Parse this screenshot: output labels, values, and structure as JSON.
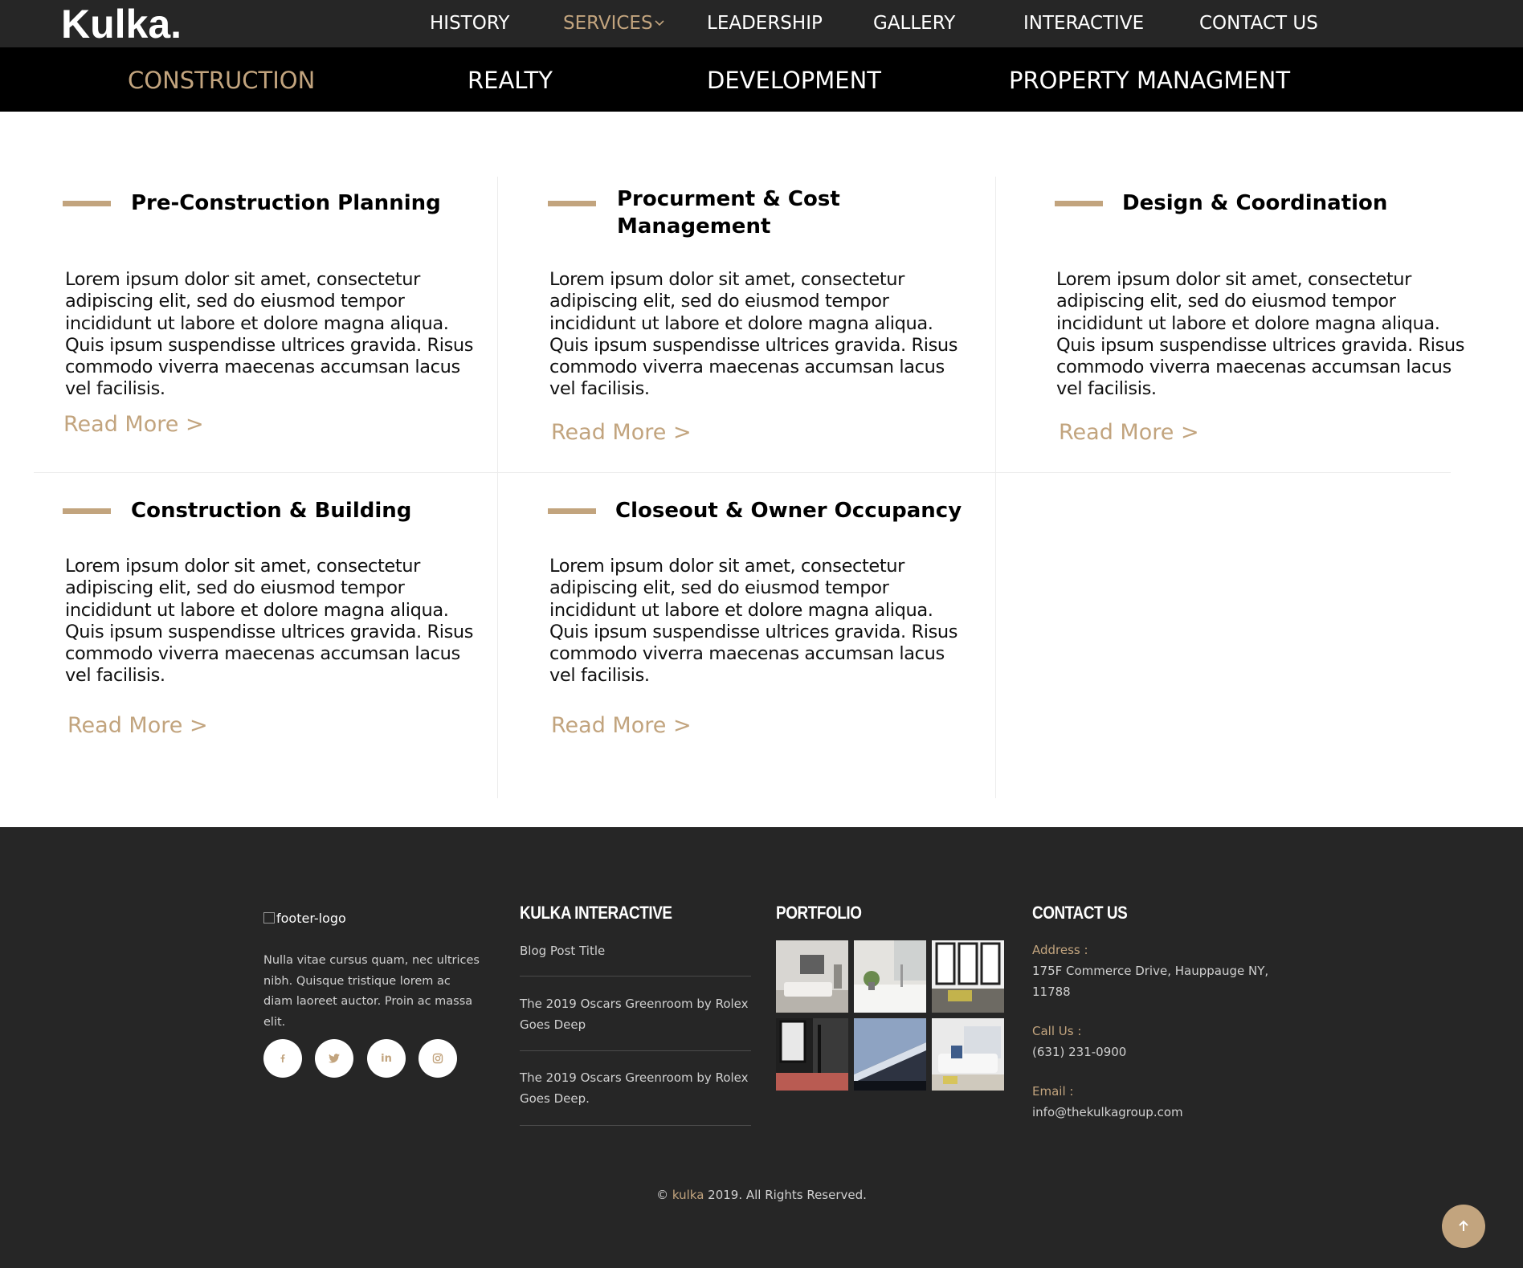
{
  "header": {
    "logo": "Kulka.",
    "nav": [
      {
        "label": "HISTORY"
      },
      {
        "label": "SERVICES"
      },
      {
        "label": "LEADERSHIP"
      },
      {
        "label": "GALLERY"
      },
      {
        "label": "INTERACTIVE"
      },
      {
        "label": "CONTACT US"
      }
    ],
    "active_nav": "SERVICES"
  },
  "subnav": {
    "items": [
      {
        "label": "CONSTRUCTION"
      },
      {
        "label": "REALTY"
      },
      {
        "label": "DEVELOPMENT"
      },
      {
        "label": "PROPERTY MANAGMENT"
      }
    ],
    "active": "CONSTRUCTION"
  },
  "services": [
    {
      "title": "Pre-Construction Planning",
      "text": "Lorem ipsum dolor sit amet, consectetur adipiscing elit, sed do eiusmod tempor incididunt ut labore et dolore magna aliqua. Quis ipsum suspendisse ultrices gravida. Risus commodo viverra maecenas accumsan lacus vel facilisis.",
      "link": "Read More >"
    },
    {
      "title": "Procurment & Cost Management",
      "text": "Lorem ipsum dolor sit amet, consectetur adipiscing elit, sed do eiusmod tempor incididunt ut labore et dolore magna aliqua. Quis ipsum suspendisse ultrices gravida. Risus commodo viverra maecenas accumsan lacus vel facilisis.",
      "link": "Read More >"
    },
    {
      "title": "Design & Coordination",
      "text": "Lorem ipsum dolor sit amet, consectetur adipiscing elit, sed do eiusmod tempor incididunt ut labore et dolore magna aliqua. Quis ipsum suspendisse ultrices gravida. Risus commodo viverra maecenas accumsan lacus vel facilisis.",
      "link": "Read More >"
    },
    {
      "title": "Construction & Building",
      "text": "Lorem ipsum dolor sit amet, consectetur adipiscing elit, sed do eiusmod tempor incididunt ut labore et dolore magna aliqua. Quis ipsum suspendisse ultrices gravida. Risus commodo viverra maecenas accumsan lacus vel facilisis.",
      "link": "Read More >"
    },
    {
      "title": "Closeout & Owner Occupancy",
      "text": "Lorem ipsum dolor sit amet, consectetur adipiscing elit, sed do eiusmod tempor incididunt ut labore et dolore magna aliqua. Quis ipsum suspendisse ultrices gravida. Risus commodo viverra maecenas accumsan lacus vel facilisis.",
      "link": "Read More >"
    }
  ],
  "footer": {
    "logo_alt": "footer-logo",
    "about": "Nulla vitae cursus quam, nec ultrices nibh. Quisque tristique lorem ac diam laoreet auctor. Proin ac massa elit.",
    "social": [
      {
        "icon": "facebook-icon"
      },
      {
        "icon": "twitter-icon"
      },
      {
        "icon": "linkedin-icon",
        "glyph": "in"
      },
      {
        "icon": "instagram-icon"
      }
    ],
    "interactive": {
      "heading": "KULKA INTERACTIVE",
      "posts": [
        {
          "title": "Blog Post Title"
        },
        {
          "title": "The 2019 Oscars Greenroom by Rolex Goes Deep"
        },
        {
          "title": "The 2019 Oscars Greenroom by Rolex Goes Deep."
        }
      ]
    },
    "portfolio": {
      "heading": "PORTFOLIO"
    },
    "contact": {
      "heading": "CONTACT US",
      "address_label": "Address :",
      "address": "175F Commerce Drive, Hauppauge NY, 11788",
      "call_label": "Call Us :",
      "phone": "(631) 231-0900",
      "email_label": "Email :",
      "email": "info@thekulkagroup.com"
    },
    "copyright_prefix": "© ",
    "copyright_brand": "kulka",
    "copyright_suffix": " 2019. All Rights Reserved."
  },
  "colors": {
    "accent": "#c2a47e",
    "nav_bg": "#262626",
    "subnav_bg": "#000000",
    "footer_bg": "#262626"
  }
}
